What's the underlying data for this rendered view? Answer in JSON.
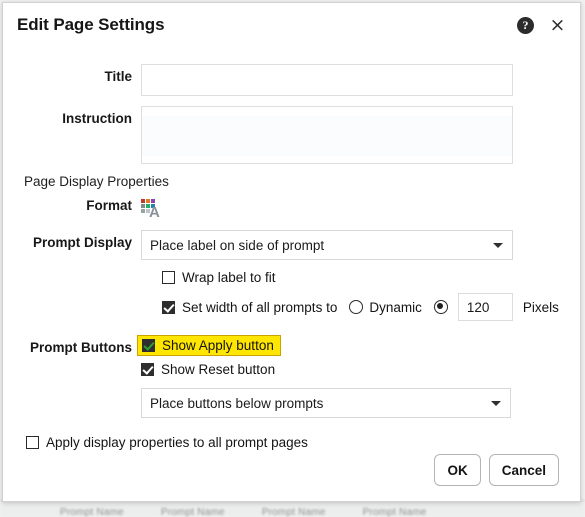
{
  "dialog": {
    "title": "Edit Page Settings",
    "help_icon": "help-circle-icon",
    "close_icon": "close-icon",
    "help_glyph": "?",
    "close_glyph": "×"
  },
  "fields": {
    "title_label": "Title",
    "title_value": "",
    "title_placeholder": "",
    "instruction_label": "Instruction",
    "instruction_value": "",
    "instruction_placeholder": ""
  },
  "page_display": {
    "section_label": "Page Display Properties",
    "format_label": "Format",
    "format_icon": "format-grid-text-icon",
    "prompt_display_label": "Prompt Display",
    "prompt_display_value": "Place label on side of prompt",
    "wrap_label_text": "Wrap label to fit",
    "wrap_label_checked": false,
    "set_width_text": "Set width of all prompts to",
    "set_width_checked": true,
    "dynamic_label": "Dynamic",
    "dynamic_selected": false,
    "pixels_selected": true,
    "pixels_value": "120",
    "pixels_label": "Pixels"
  },
  "prompt_buttons": {
    "section_label": "Prompt Buttons",
    "show_apply_text": "Show Apply button",
    "show_apply_checked": true,
    "show_apply_highlighted": true,
    "show_reset_text": "Show Reset button",
    "show_reset_checked": true,
    "placement_value": "Place buttons below prompts"
  },
  "footer": {
    "apply_all_text": "Apply display properties to all prompt pages",
    "apply_all_checked": false,
    "ok_label": "OK",
    "cancel_label": "Cancel"
  },
  "background": {
    "row_items": [
      "Prompt Name",
      "Prompt Name",
      "Prompt Name",
      "Prompt Name"
    ]
  },
  "colors": {
    "highlight": "#ffe600",
    "checkbox_fill": "#2e2e2e",
    "accent_check_green": "#2f9e2f"
  }
}
